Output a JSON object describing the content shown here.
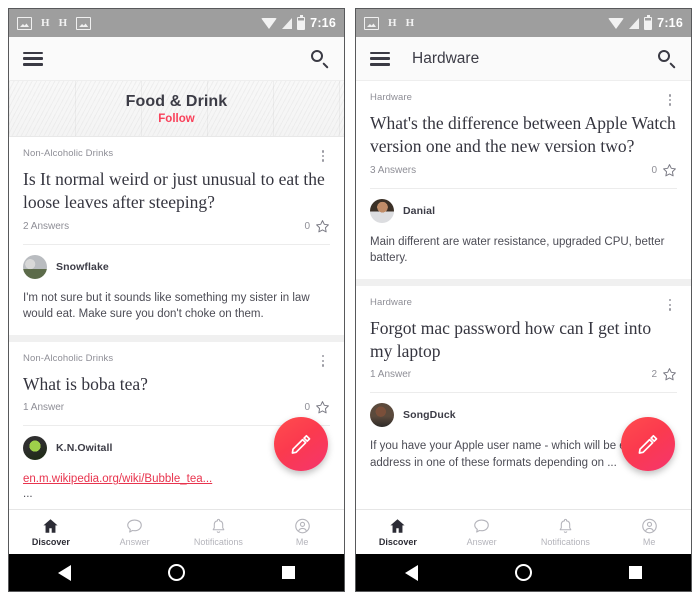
{
  "status_bar": {
    "icons": [
      "photo-icon",
      "h-label",
      "h-label",
      "image-icon"
    ],
    "h1": "H",
    "h2": "H",
    "time": "7:16",
    "wifi": "wifi-icon",
    "signal": "signal-icon",
    "battery": "battery-icon"
  },
  "colors": {
    "accent": "#f9405a",
    "link": "#e8344e",
    "statusbar": "#9e9e9e",
    "toolbar": "#fafafa",
    "card_gap": "#f0f0f0",
    "text_primary": "#35353f",
    "text_muted": "#8e8e96"
  },
  "bottom_nav": {
    "items": [
      {
        "label": "Discover",
        "icon": "home-icon",
        "active": true
      },
      {
        "label": "Answer",
        "icon": "speech-bubble-icon",
        "active": false
      },
      {
        "label": "Notifications",
        "icon": "bell-icon",
        "active": false
      },
      {
        "label": "Me",
        "icon": "account-circle-icon",
        "active": false
      }
    ]
  },
  "system_nav": {
    "back": "back-triangle-icon",
    "home": "home-circle-icon",
    "recents": "recents-square-icon"
  },
  "fab": {
    "icon": "pencil-icon",
    "label": "Compose"
  },
  "screens": [
    {
      "id": "food-and-drink",
      "toolbar": {
        "menu_icon": "hamburger-icon",
        "title": "",
        "search_icon": "search-icon"
      },
      "topic_banner": {
        "title": "Food & Drink",
        "follow_label": "Follow"
      },
      "cards": [
        {
          "topic": "Non-Alcoholic Drinks",
          "title": "Is It normal weird or just unusual to eat the loose leaves after steeping?",
          "answers": "2 Answers",
          "stars": "0",
          "author": "Snowflake",
          "avatar": "ava-snow",
          "body": "I'm not sure but it sounds like something my sister in law would eat. Make sure you don't choke on them.",
          "link": ""
        },
        {
          "topic": "Non-Alcoholic Drinks",
          "title": "What is boba tea?",
          "answers": "1 Answer",
          "stars": "0",
          "author": "K.N.Owitall",
          "avatar": "ava-kn",
          "body": "",
          "link": "en.m.wikipedia.org/wiki/Bubble_tea...",
          "ellipsis": "..."
        }
      ]
    },
    {
      "id": "hardware",
      "toolbar": {
        "menu_icon": "hamburger-icon",
        "title": "Hardware",
        "search_icon": "search-icon"
      },
      "topic_banner": null,
      "cards": [
        {
          "topic": "Hardware",
          "title": "What's the difference between Apple Watch version one and the new version two?",
          "answers": "3 Answers",
          "stars": "0",
          "author": "Danial",
          "avatar": "ava-danial",
          "body": "Main different are water resistance, upgraded CPU, better battery.",
          "link": ""
        },
        {
          "topic": "Hardware",
          "title": "Forgot mac password how can I get into my laptop",
          "answers": "1 Answer",
          "stars": "2",
          "author": "SongDuck",
          "avatar": "ava-song",
          "body": "If you have your Apple user name - which will be email address in one of these formats depending on ...",
          "link": ""
        }
      ]
    }
  ]
}
